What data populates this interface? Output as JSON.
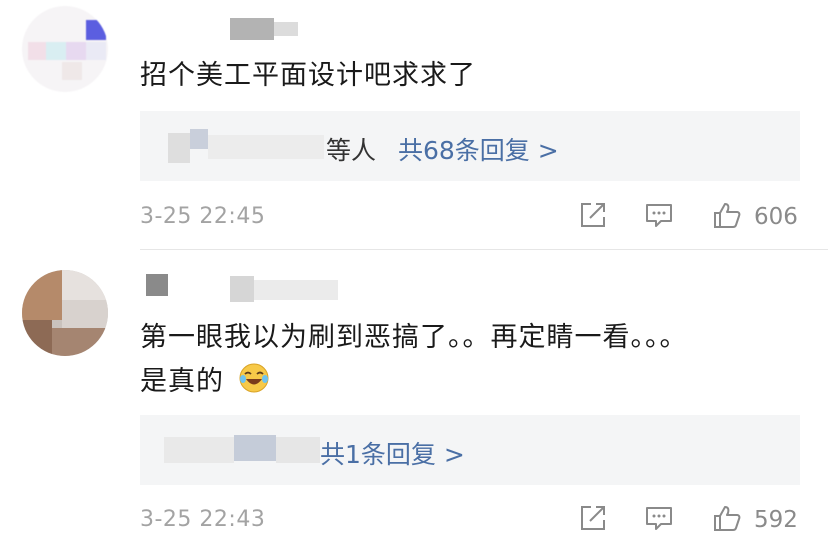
{
  "comments": [
    {
      "text": "招个美工平面设计吧求求了",
      "reply_suffix": "等人",
      "reply_more": "共68条回复 >",
      "time": "3-25 22:45",
      "likes": "606",
      "icons": [
        "share-icon",
        "comment-icon",
        "like-icon"
      ]
    },
    {
      "text_line1": "第一眼我以为刷到恶搞了。。再定睛一看。。。",
      "text_line2": "是真的",
      "emoji": "laugh-cry-emoji",
      "reply_more": "共1条回复 >",
      "time": "3-25 22:43",
      "likes": "592",
      "icons": [
        "share-icon",
        "comment-icon",
        "like-icon"
      ]
    }
  ],
  "colors": {
    "link": "#4a6fa5",
    "muted": "#a3a3a3",
    "reply_bg": "#f4f5f6"
  }
}
